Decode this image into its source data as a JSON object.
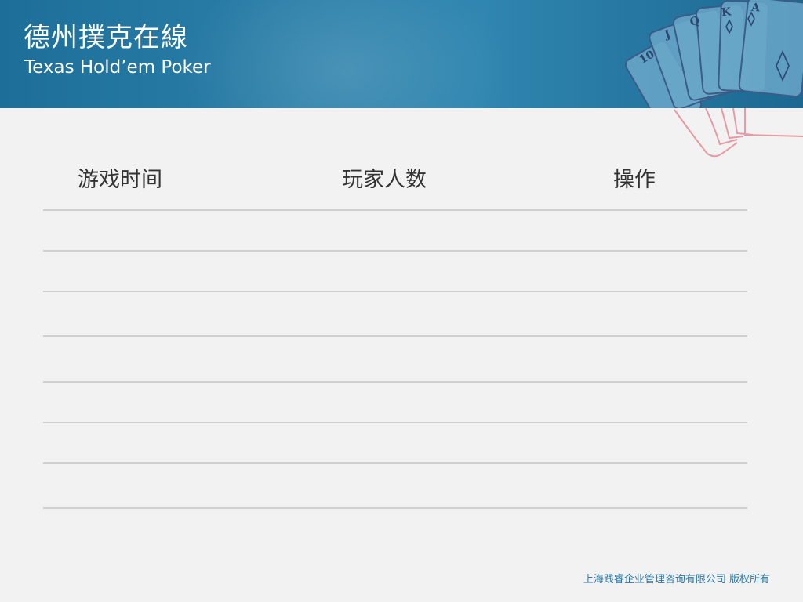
{
  "header": {
    "title_cn": "德州撲克在線",
    "title_en": "Texas Hold’em Poker",
    "cards_icon": "royal-flush-cards-icon"
  },
  "table": {
    "columns": [
      "游戏时间",
      "玩家人数",
      "操作"
    ],
    "rows": [
      [
        "",
        "",
        ""
      ],
      [
        "",
        "",
        ""
      ],
      [
        "",
        "",
        ""
      ],
      [
        "",
        "",
        ""
      ],
      [
        "",
        "",
        ""
      ],
      [
        "",
        "",
        ""
      ],
      [
        "",
        "",
        ""
      ]
    ]
  },
  "footer": {
    "copyright": "上海践睿企业管理咨询有限公司 版权所有"
  },
  "colors": {
    "header": "#2a7ea8",
    "background": "#f2f2f2",
    "footer_text": "#2b78a6",
    "card_outline": "#e89aa4"
  }
}
